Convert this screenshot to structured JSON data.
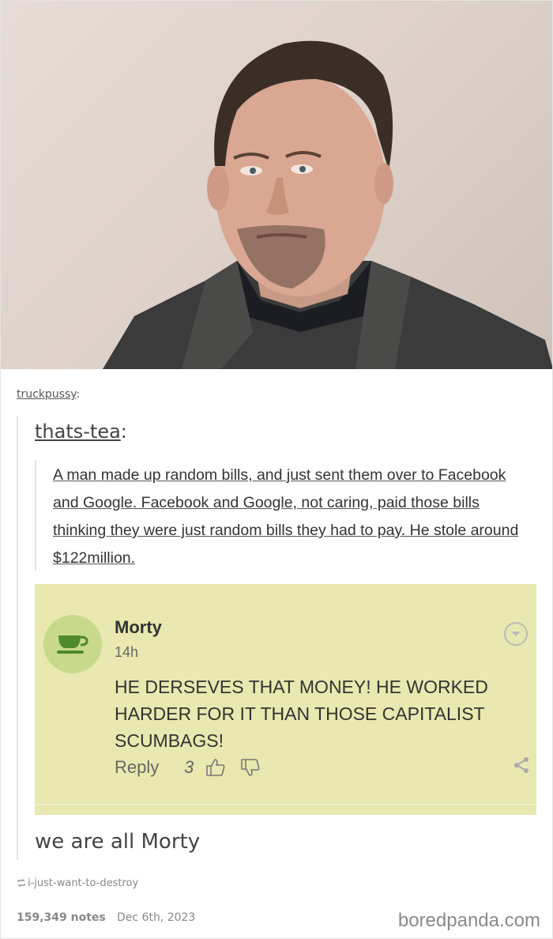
{
  "post": {
    "photo_alt": "man-portrait-photo",
    "poster": "truckpussy",
    "poster_sep": ":",
    "inner_author": "thats-tea",
    "inner_sep": ":",
    "story": "A man made up random bills, and just sent them over to Facebook and Google. Facebook and Google, not caring, paid those bills thinking they were just random bills they had to pay. He stole around $122million.",
    "comment": {
      "name": "Morty",
      "time": "14h",
      "text": "HE DERSEVES THAT MONEY! HE WORKED HARDER FOR IT THAN THOSE CAPITALIST SCUMBAGS!",
      "reply_label": "Reply",
      "likes": "3",
      "avatar_icon": "teacup-icon",
      "bg_color": "#e8e8b0"
    },
    "reply": "we are all Morty",
    "reblog_source": "i-just-want-to-destroy",
    "notes": "159,349 notes",
    "date": "Dec 6th, 2023"
  },
  "watermark": "boredpanda.com"
}
